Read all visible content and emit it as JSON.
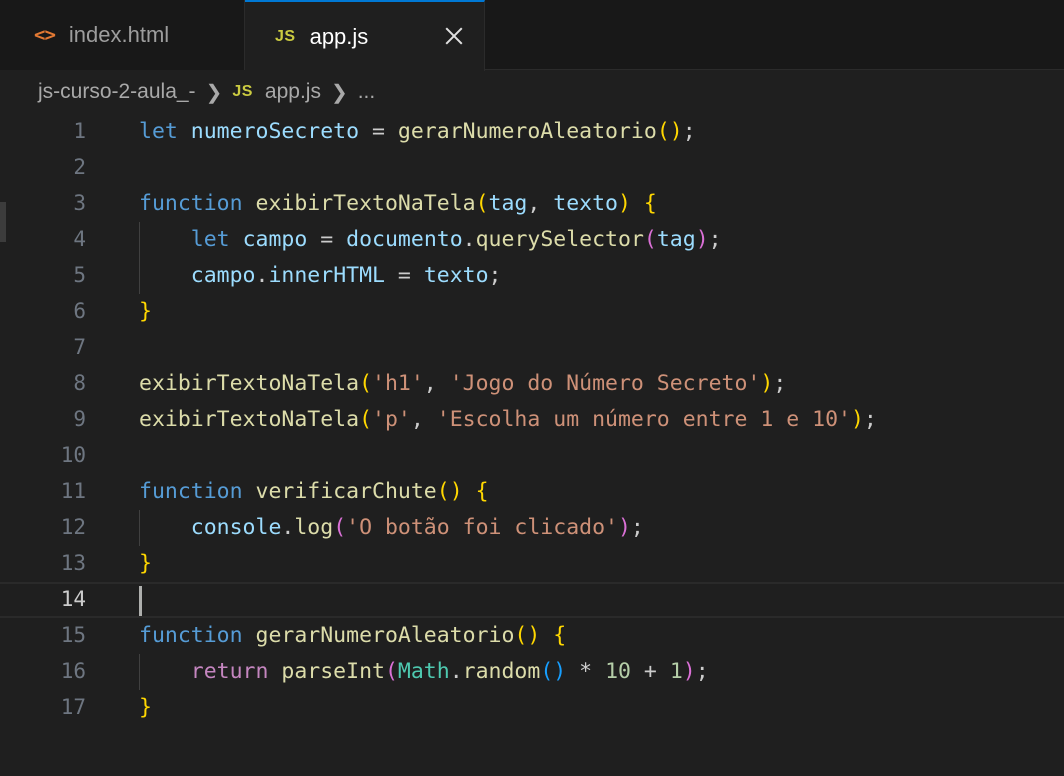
{
  "tabs": [
    {
      "label": "index.html",
      "icon": "html-file-icon",
      "active": false
    },
    {
      "label": "app.js",
      "icon": "js-file-icon",
      "active": true
    }
  ],
  "js_icon_text": "JS",
  "html_icon_text": "<>",
  "breadcrumb": {
    "folder": "js-curso-2-aula_-",
    "file": "app.js",
    "more": "..."
  },
  "line_numbers": [
    "1",
    "2",
    "3",
    "4",
    "5",
    "6",
    "7",
    "8",
    "9",
    "10",
    "11",
    "12",
    "13",
    "14",
    "15",
    "16",
    "17"
  ],
  "current_line": 14,
  "code": {
    "l1": {
      "kw": "let",
      "var": "numeroSecreto",
      "op": " = ",
      "fn": "gerarNumeroAleatorio",
      "open": "(",
      "close": ")",
      "end": ";"
    },
    "l3": {
      "kw": "function",
      "fn": "exibirTextoNaTela",
      "open": "(",
      "p1": "tag",
      "comma": ", ",
      "p2": "texto",
      "close": ")",
      "brace": "{"
    },
    "l4": {
      "kw": "let",
      "var": "campo",
      "op": " = ",
      "obj": "documento",
      "dot": ".",
      "fn": "querySelector",
      "open": "(",
      "arg": "tag",
      "close": ")",
      "end": ";"
    },
    "l5": {
      "obj": "campo",
      "dot": ".",
      "prop": "innerHTML",
      "op": " = ",
      "val": "texto",
      "end": ";"
    },
    "l6": {
      "brace": "}"
    },
    "l8": {
      "fn": "exibirTextoNaTela",
      "open": "(",
      "s1": "'h1'",
      "comma": ", ",
      "s2": "'Jogo do Número Secreto'",
      "close": ")",
      "end": ";"
    },
    "l9": {
      "fn": "exibirTextoNaTela",
      "open": "(",
      "s1": "'p'",
      "comma": ", ",
      "s2": "'Escolha um número entre 1 e 10'",
      "close": ")",
      "end": ";"
    },
    "l11": {
      "kw": "function",
      "fn": "verificarChute",
      "open": "(",
      "close": ")",
      "brace": "{"
    },
    "l12": {
      "obj": "console",
      "dot": ".",
      "fn": "log",
      "open": "(",
      "s1": "'O botão foi clicado'",
      "close": ")",
      "end": ";"
    },
    "l13": {
      "brace": "}"
    },
    "l15": {
      "kw": "function",
      "fn": "gerarNumeroAleatorio",
      "open": "(",
      "close": ")",
      "brace": "{"
    },
    "l16": {
      "kw": "return",
      "fn": "parseInt",
      "open": "(",
      "cls": "Math",
      "dot": ".",
      "fn2": "random",
      "open2": "(",
      "close2": ")",
      "op1": " * ",
      "n1": "10",
      "op2": " + ",
      "n2": "1",
      "close": ")",
      "end": ";"
    },
    "l17": {
      "brace": "}"
    }
  },
  "colors": {
    "background": "#1f1f1f",
    "tab_active_border": "#0078d4",
    "keyword": "#569cd6",
    "control_keyword": "#c586c0",
    "function": "#dcdcaa",
    "variable": "#9cdcfe",
    "string": "#ce9178",
    "number": "#b5cea8",
    "bracket_gold": "#ffd700",
    "bracket_orchid": "#da70d6",
    "bracket_blue": "#179fff",
    "class": "#4ec9b0"
  }
}
